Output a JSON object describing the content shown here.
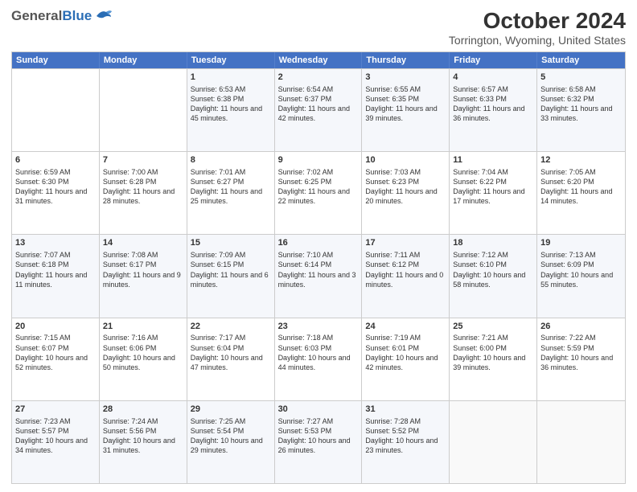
{
  "header": {
    "logo_general": "General",
    "logo_blue": "Blue",
    "title": "October 2024",
    "subtitle": "Torrington, Wyoming, United States"
  },
  "days_of_week": [
    "Sunday",
    "Monday",
    "Tuesday",
    "Wednesday",
    "Thursday",
    "Friday",
    "Saturday"
  ],
  "weeks": [
    [
      {
        "day": "",
        "sunrise": "",
        "sunset": "",
        "daylight": "",
        "empty": true
      },
      {
        "day": "",
        "sunrise": "",
        "sunset": "",
        "daylight": "",
        "empty": true
      },
      {
        "day": "1",
        "sunrise": "Sunrise: 6:53 AM",
        "sunset": "Sunset: 6:38 PM",
        "daylight": "Daylight: 11 hours and 45 minutes.",
        "empty": false
      },
      {
        "day": "2",
        "sunrise": "Sunrise: 6:54 AM",
        "sunset": "Sunset: 6:37 PM",
        "daylight": "Daylight: 11 hours and 42 minutes.",
        "empty": false
      },
      {
        "day": "3",
        "sunrise": "Sunrise: 6:55 AM",
        "sunset": "Sunset: 6:35 PM",
        "daylight": "Daylight: 11 hours and 39 minutes.",
        "empty": false
      },
      {
        "day": "4",
        "sunrise": "Sunrise: 6:57 AM",
        "sunset": "Sunset: 6:33 PM",
        "daylight": "Daylight: 11 hours and 36 minutes.",
        "empty": false
      },
      {
        "day": "5",
        "sunrise": "Sunrise: 6:58 AM",
        "sunset": "Sunset: 6:32 PM",
        "daylight": "Daylight: 11 hours and 33 minutes.",
        "empty": false
      }
    ],
    [
      {
        "day": "6",
        "sunrise": "Sunrise: 6:59 AM",
        "sunset": "Sunset: 6:30 PM",
        "daylight": "Daylight: 11 hours and 31 minutes.",
        "empty": false
      },
      {
        "day": "7",
        "sunrise": "Sunrise: 7:00 AM",
        "sunset": "Sunset: 6:28 PM",
        "daylight": "Daylight: 11 hours and 28 minutes.",
        "empty": false
      },
      {
        "day": "8",
        "sunrise": "Sunrise: 7:01 AM",
        "sunset": "Sunset: 6:27 PM",
        "daylight": "Daylight: 11 hours and 25 minutes.",
        "empty": false
      },
      {
        "day": "9",
        "sunrise": "Sunrise: 7:02 AM",
        "sunset": "Sunset: 6:25 PM",
        "daylight": "Daylight: 11 hours and 22 minutes.",
        "empty": false
      },
      {
        "day": "10",
        "sunrise": "Sunrise: 7:03 AM",
        "sunset": "Sunset: 6:23 PM",
        "daylight": "Daylight: 11 hours and 20 minutes.",
        "empty": false
      },
      {
        "day": "11",
        "sunrise": "Sunrise: 7:04 AM",
        "sunset": "Sunset: 6:22 PM",
        "daylight": "Daylight: 11 hours and 17 minutes.",
        "empty": false
      },
      {
        "day": "12",
        "sunrise": "Sunrise: 7:05 AM",
        "sunset": "Sunset: 6:20 PM",
        "daylight": "Daylight: 11 hours and 14 minutes.",
        "empty": false
      }
    ],
    [
      {
        "day": "13",
        "sunrise": "Sunrise: 7:07 AM",
        "sunset": "Sunset: 6:18 PM",
        "daylight": "Daylight: 11 hours and 11 minutes.",
        "empty": false
      },
      {
        "day": "14",
        "sunrise": "Sunrise: 7:08 AM",
        "sunset": "Sunset: 6:17 PM",
        "daylight": "Daylight: 11 hours and 9 minutes.",
        "empty": false
      },
      {
        "day": "15",
        "sunrise": "Sunrise: 7:09 AM",
        "sunset": "Sunset: 6:15 PM",
        "daylight": "Daylight: 11 hours and 6 minutes.",
        "empty": false
      },
      {
        "day": "16",
        "sunrise": "Sunrise: 7:10 AM",
        "sunset": "Sunset: 6:14 PM",
        "daylight": "Daylight: 11 hours and 3 minutes.",
        "empty": false
      },
      {
        "day": "17",
        "sunrise": "Sunrise: 7:11 AM",
        "sunset": "Sunset: 6:12 PM",
        "daylight": "Daylight: 11 hours and 0 minutes.",
        "empty": false
      },
      {
        "day": "18",
        "sunrise": "Sunrise: 7:12 AM",
        "sunset": "Sunset: 6:10 PM",
        "daylight": "Daylight: 10 hours and 58 minutes.",
        "empty": false
      },
      {
        "day": "19",
        "sunrise": "Sunrise: 7:13 AM",
        "sunset": "Sunset: 6:09 PM",
        "daylight": "Daylight: 10 hours and 55 minutes.",
        "empty": false
      }
    ],
    [
      {
        "day": "20",
        "sunrise": "Sunrise: 7:15 AM",
        "sunset": "Sunset: 6:07 PM",
        "daylight": "Daylight: 10 hours and 52 minutes.",
        "empty": false
      },
      {
        "day": "21",
        "sunrise": "Sunrise: 7:16 AM",
        "sunset": "Sunset: 6:06 PM",
        "daylight": "Daylight: 10 hours and 50 minutes.",
        "empty": false
      },
      {
        "day": "22",
        "sunrise": "Sunrise: 7:17 AM",
        "sunset": "Sunset: 6:04 PM",
        "daylight": "Daylight: 10 hours and 47 minutes.",
        "empty": false
      },
      {
        "day": "23",
        "sunrise": "Sunrise: 7:18 AM",
        "sunset": "Sunset: 6:03 PM",
        "daylight": "Daylight: 10 hours and 44 minutes.",
        "empty": false
      },
      {
        "day": "24",
        "sunrise": "Sunrise: 7:19 AM",
        "sunset": "Sunset: 6:01 PM",
        "daylight": "Daylight: 10 hours and 42 minutes.",
        "empty": false
      },
      {
        "day": "25",
        "sunrise": "Sunrise: 7:21 AM",
        "sunset": "Sunset: 6:00 PM",
        "daylight": "Daylight: 10 hours and 39 minutes.",
        "empty": false
      },
      {
        "day": "26",
        "sunrise": "Sunrise: 7:22 AM",
        "sunset": "Sunset: 5:59 PM",
        "daylight": "Daylight: 10 hours and 36 minutes.",
        "empty": false
      }
    ],
    [
      {
        "day": "27",
        "sunrise": "Sunrise: 7:23 AM",
        "sunset": "Sunset: 5:57 PM",
        "daylight": "Daylight: 10 hours and 34 minutes.",
        "empty": false
      },
      {
        "day": "28",
        "sunrise": "Sunrise: 7:24 AM",
        "sunset": "Sunset: 5:56 PM",
        "daylight": "Daylight: 10 hours and 31 minutes.",
        "empty": false
      },
      {
        "day": "29",
        "sunrise": "Sunrise: 7:25 AM",
        "sunset": "Sunset: 5:54 PM",
        "daylight": "Daylight: 10 hours and 29 minutes.",
        "empty": false
      },
      {
        "day": "30",
        "sunrise": "Sunrise: 7:27 AM",
        "sunset": "Sunset: 5:53 PM",
        "daylight": "Daylight: 10 hours and 26 minutes.",
        "empty": false
      },
      {
        "day": "31",
        "sunrise": "Sunrise: 7:28 AM",
        "sunset": "Sunset: 5:52 PM",
        "daylight": "Daylight: 10 hours and 23 minutes.",
        "empty": false
      },
      {
        "day": "",
        "sunrise": "",
        "sunset": "",
        "daylight": "",
        "empty": true
      },
      {
        "day": "",
        "sunrise": "",
        "sunset": "",
        "daylight": "",
        "empty": true
      }
    ]
  ]
}
